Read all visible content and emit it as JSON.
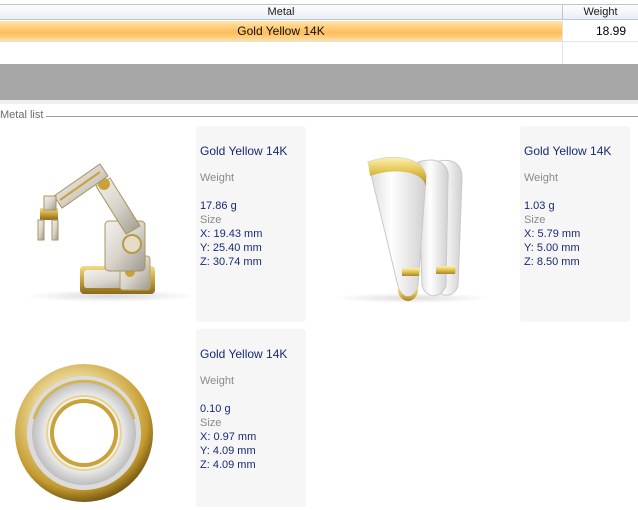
{
  "grid": {
    "columns": {
      "metal": "Metal",
      "weight": "Weight"
    },
    "rows": [
      {
        "metal": "Gold Yellow 14K",
        "weight": "18.99"
      }
    ]
  },
  "metal_list": {
    "title": "Metal list",
    "items": [
      {
        "name": "Gold Yellow 14K",
        "weight_label": "Weight",
        "weight": "17.86 g",
        "size_label": "Size",
        "x": "X: 19.43 mm",
        "y": "Y: 25.40 mm",
        "z": "Z: 30.74 mm",
        "thumbnail": "robot-arm-model"
      },
      {
        "name": "Gold Yellow 14K",
        "weight_label": "Weight",
        "weight": "1.03 g",
        "size_label": "Size",
        "x": "X: 5.79 mm",
        "y": "Y: 5.00 mm",
        "z": "Z: 8.50 mm",
        "thumbnail": "ring-shank-model"
      },
      {
        "name": "Gold Yellow 14K",
        "weight_label": "Weight",
        "weight": "0.10 g",
        "size_label": "Size",
        "x": "X: 0.97 mm",
        "y": "Y: 4.09 mm",
        "z": "Z: 4.09 mm",
        "thumbnail": "gold-ring-model"
      }
    ]
  },
  "colors": {
    "selection": "#ffc56c",
    "info_text": "#172b74",
    "label_text": "#8a8a8a",
    "gold": "#c9a23a"
  }
}
